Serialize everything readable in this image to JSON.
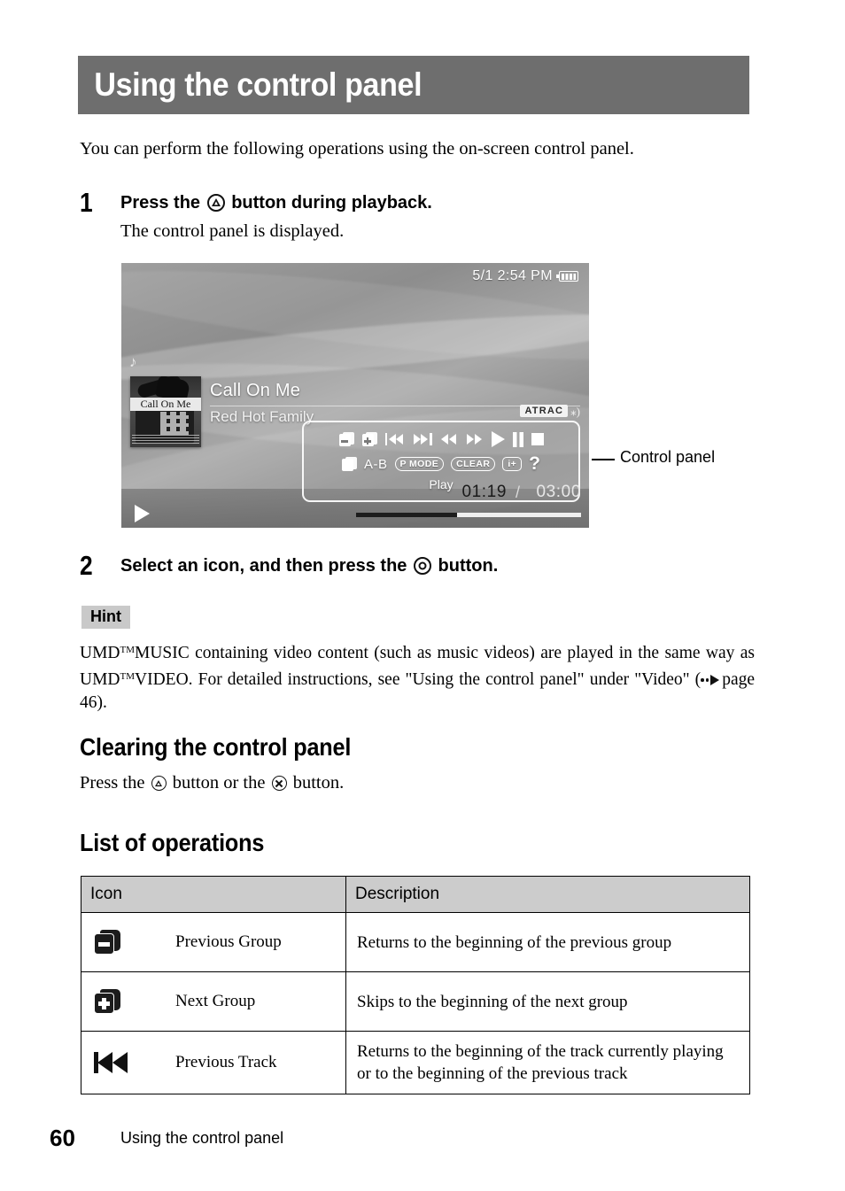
{
  "page": {
    "title": "Using the control panel",
    "intro": "You can perform the following operations using the on-screen control panel.",
    "footer_number": "60",
    "footer_text": "Using the control panel"
  },
  "steps": [
    {
      "number": "1",
      "head_before": "Press the",
      "button": "triangle-button",
      "head_after": "button during playback.",
      "sub": "The control panel is displayed."
    },
    {
      "number": "2",
      "head_before": "Select an icon, and then press the",
      "button": "circle-button",
      "head_after": "button.",
      "sub": ""
    }
  ],
  "figure": {
    "callout_label": "Control panel",
    "status": {
      "datetime": "5/1 2:54 PM",
      "battery_icon": "battery-icon"
    },
    "note_icon": "music-note-icon",
    "album_art_caption": "Call On Me",
    "track_title": "Call On Me",
    "track_artist": "Red Hot Family",
    "format_badge": "ATRAC",
    "control_panel": {
      "row1": [
        {
          "icon": "previous-group-icon",
          "label": ""
        },
        {
          "icon": "next-group-icon",
          "label": ""
        },
        {
          "icon": "previous-track-icon",
          "label": ""
        },
        {
          "icon": "next-track-icon",
          "label": ""
        },
        {
          "icon": "rewind-icon",
          "label": ""
        },
        {
          "icon": "fast-forward-icon",
          "label": ""
        },
        {
          "icon": "play-icon",
          "label": ""
        },
        {
          "icon": "pause-icon",
          "label": ""
        },
        {
          "icon": "stop-icon",
          "label": ""
        }
      ],
      "row2": [
        {
          "icon": "display-mode-icon",
          "label": ""
        },
        {
          "icon": "ab-repeat-icon",
          "label": "A-B"
        },
        {
          "icon": "play-mode-icon",
          "label": "P MODE"
        },
        {
          "icon": "clear-icon",
          "label": "CLEAR"
        },
        {
          "icon": "info-icon",
          "label": "i+"
        },
        {
          "icon": "help-icon",
          "label": "?"
        }
      ],
      "status_label": "Play"
    },
    "playback": {
      "current_time": "01:19",
      "separator": "/",
      "total_time": "03:00",
      "progress_percent": 45
    }
  },
  "hint": {
    "badge": "Hint",
    "text_part1": "UMD",
    "tm1": "TM",
    "text_part2": "MUSIC containing video content (such as music videos) are played in the same way as UMD",
    "tm2": "TM",
    "text_part3": "VIDEO. For detailed instructions, see \"Using the control panel\" under \"Video\" (",
    "page_ref": "page 46",
    "text_part4": ")."
  },
  "sections": [
    {
      "id": "clearing",
      "heading": "Clearing the control panel",
      "body_before": "Press the",
      "body_mid": "button or the",
      "body_after": "button."
    },
    {
      "id": "list",
      "heading": "List of operations"
    }
  ],
  "table": {
    "headers": [
      "Icon",
      "Description"
    ],
    "rows": [
      {
        "icon": "previous-group-icon",
        "icon_label": "Previous Group",
        "description": "Returns to the beginning of the previous group"
      },
      {
        "icon": "next-group-icon",
        "icon_label": "Next Group",
        "description": "Skips to the beginning of the next group"
      },
      {
        "icon": "previous-track-icon",
        "icon_label": "Previous Track",
        "description": "Returns to the beginning of the track currently playing or to the beginning of the previous track"
      }
    ]
  },
  "colors": {
    "header_band": "#6e6e6e",
    "table_header": "#cccccc",
    "hint_badge": "#c9c9c9"
  }
}
